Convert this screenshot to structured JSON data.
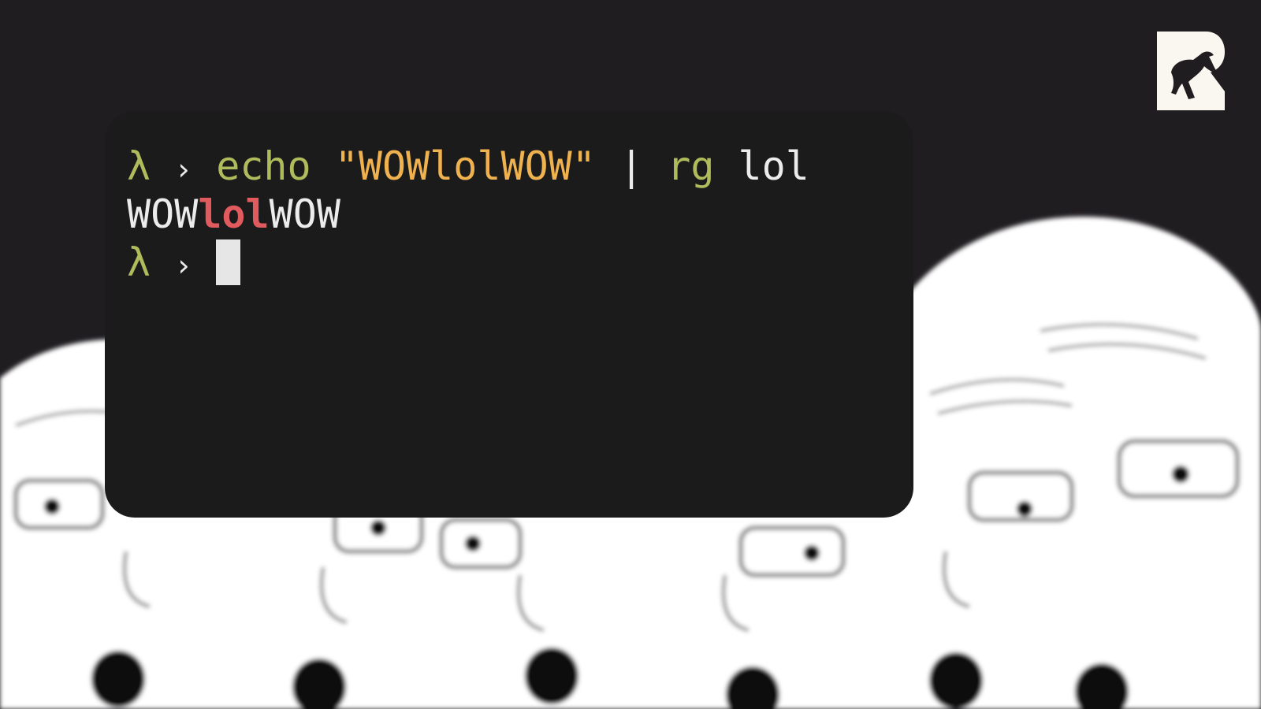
{
  "colors": {
    "background": "#201d21",
    "terminal_bg": "#1b1b1c",
    "prompt": "#b0bc5c",
    "command": "#b0bc5c",
    "string": "#f0b24e",
    "text": "#ececec",
    "match": "#e05a5e",
    "logo_bg": "#faf6f0",
    "logo_fg": "#201d21"
  },
  "logo": {
    "icon": "bull-head-R-logo"
  },
  "background_art": {
    "icon": "shocked-bald-faces-meme-blurred"
  },
  "terminal": {
    "lines": [
      {
        "prompt_symbol": "λ",
        "prompt_arrow": "›",
        "command": "echo",
        "string_arg": "\"WOWlolWOW\"",
        "pipe": "|",
        "pipe_command": "rg",
        "pattern": "lol"
      },
      {
        "output_before": "WOW",
        "output_match": "lol",
        "output_after": "WOW"
      },
      {
        "prompt_symbol": "λ",
        "prompt_arrow": "›",
        "cursor": "block-cursor-icon"
      }
    ]
  }
}
